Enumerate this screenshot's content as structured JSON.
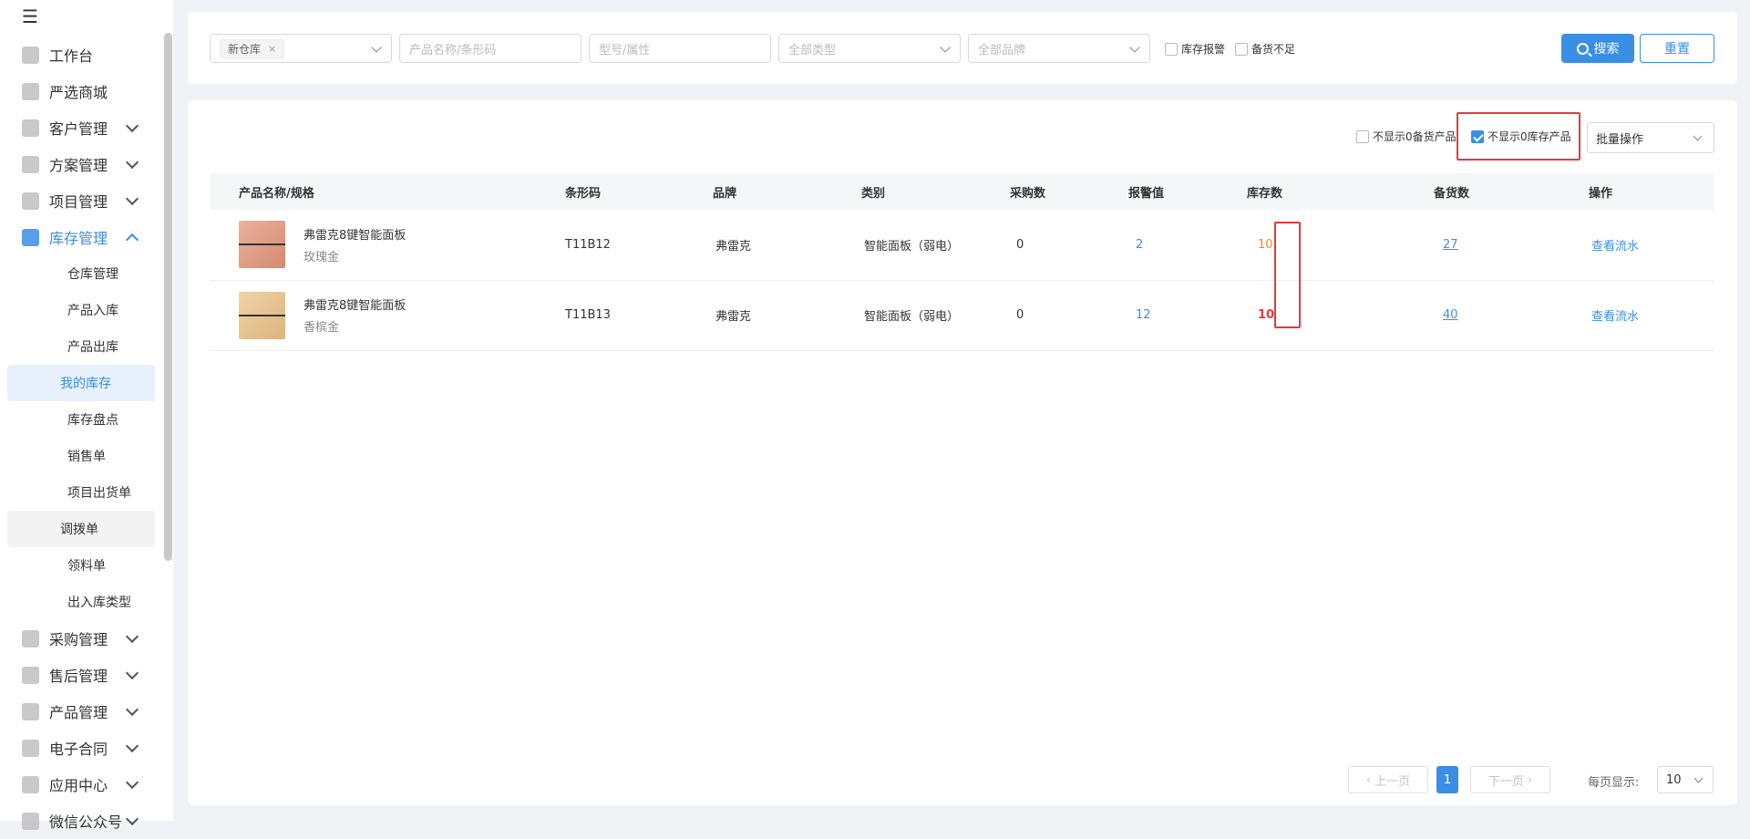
{
  "sidebar": {
    "items": [
      {
        "label": "工作台",
        "icon": "home-icon"
      },
      {
        "label": "严选商城",
        "icon": "mall-icon"
      },
      {
        "label": "客户管理",
        "icon": "customer-icon"
      },
      {
        "label": "方案管理",
        "icon": "plan-icon"
      },
      {
        "label": "项目管理",
        "icon": "folder-icon"
      },
      {
        "label": "库存管理",
        "icon": "inventory-icon"
      }
    ],
    "sub_items": [
      "仓库管理",
      "产品入库",
      "产品出库",
      "我的库存",
      "库存盘点",
      "销售单",
      "项目出货单",
      "调拨单",
      "领料单",
      "出入库类型"
    ],
    "bottom_items": [
      {
        "label": "采购管理",
        "icon": "cart-icon"
      },
      {
        "label": "售后管理",
        "icon": "headset-icon"
      },
      {
        "label": "产品管理",
        "icon": "box-icon"
      },
      {
        "label": "电子合同",
        "icon": "contract-icon"
      },
      {
        "label": "应用中心",
        "icon": "apps-icon"
      },
      {
        "label": "微信公众号",
        "icon": "wechat-icon"
      }
    ]
  },
  "filters": {
    "warehouse_tag": "新仓库",
    "name_placeholder": "产品名称/条形码",
    "model_placeholder": "型号/属性",
    "type_placeholder": "全部类型",
    "brand_placeholder": "全部品牌",
    "chk_stock_alarm": "库存报警",
    "chk_insufficient": "备货不足",
    "search_label": "搜索",
    "reset_label": "重置"
  },
  "options": {
    "hide_zero_reserve": "不显示0备货产品",
    "hide_zero_stock": "不显示0库存产品",
    "batch": "批量操作"
  },
  "table": {
    "headers": [
      "产品名称/规格",
      "条形码",
      "品牌",
      "类别",
      "采购数",
      "报警值",
      "库存数",
      "备货数",
      "操作"
    ],
    "rows": [
      {
        "name": "弗雷克8键智能面板",
        "spec": "玫瑰金",
        "barcode": "T11B12",
        "brand": "弗雷克",
        "category": "智能面板（弱电）",
        "purchase": "0",
        "alarm": "2",
        "stock": "10",
        "reserve": "27",
        "action": "查看流水",
        "thumb_color": "#e8a48c"
      },
      {
        "name": "弗雷克8键智能面板",
        "spec": "香槟金",
        "barcode": "T11B13",
        "brand": "弗雷克",
        "category": "智能面板（弱电）",
        "purchase": "0",
        "alarm": "12",
        "stock": "10",
        "reserve": "40",
        "action": "查看流水",
        "thumb_color": "#e9c797"
      }
    ]
  },
  "pagination": {
    "prev": "上一页",
    "next": "下一页",
    "current": "1",
    "page_size_label": "每页显示:",
    "page_size": "10"
  },
  "colors": {
    "accent": "#3a8ee6",
    "alert_red": "#e23b3b",
    "warn_orange": "#f08a24"
  }
}
